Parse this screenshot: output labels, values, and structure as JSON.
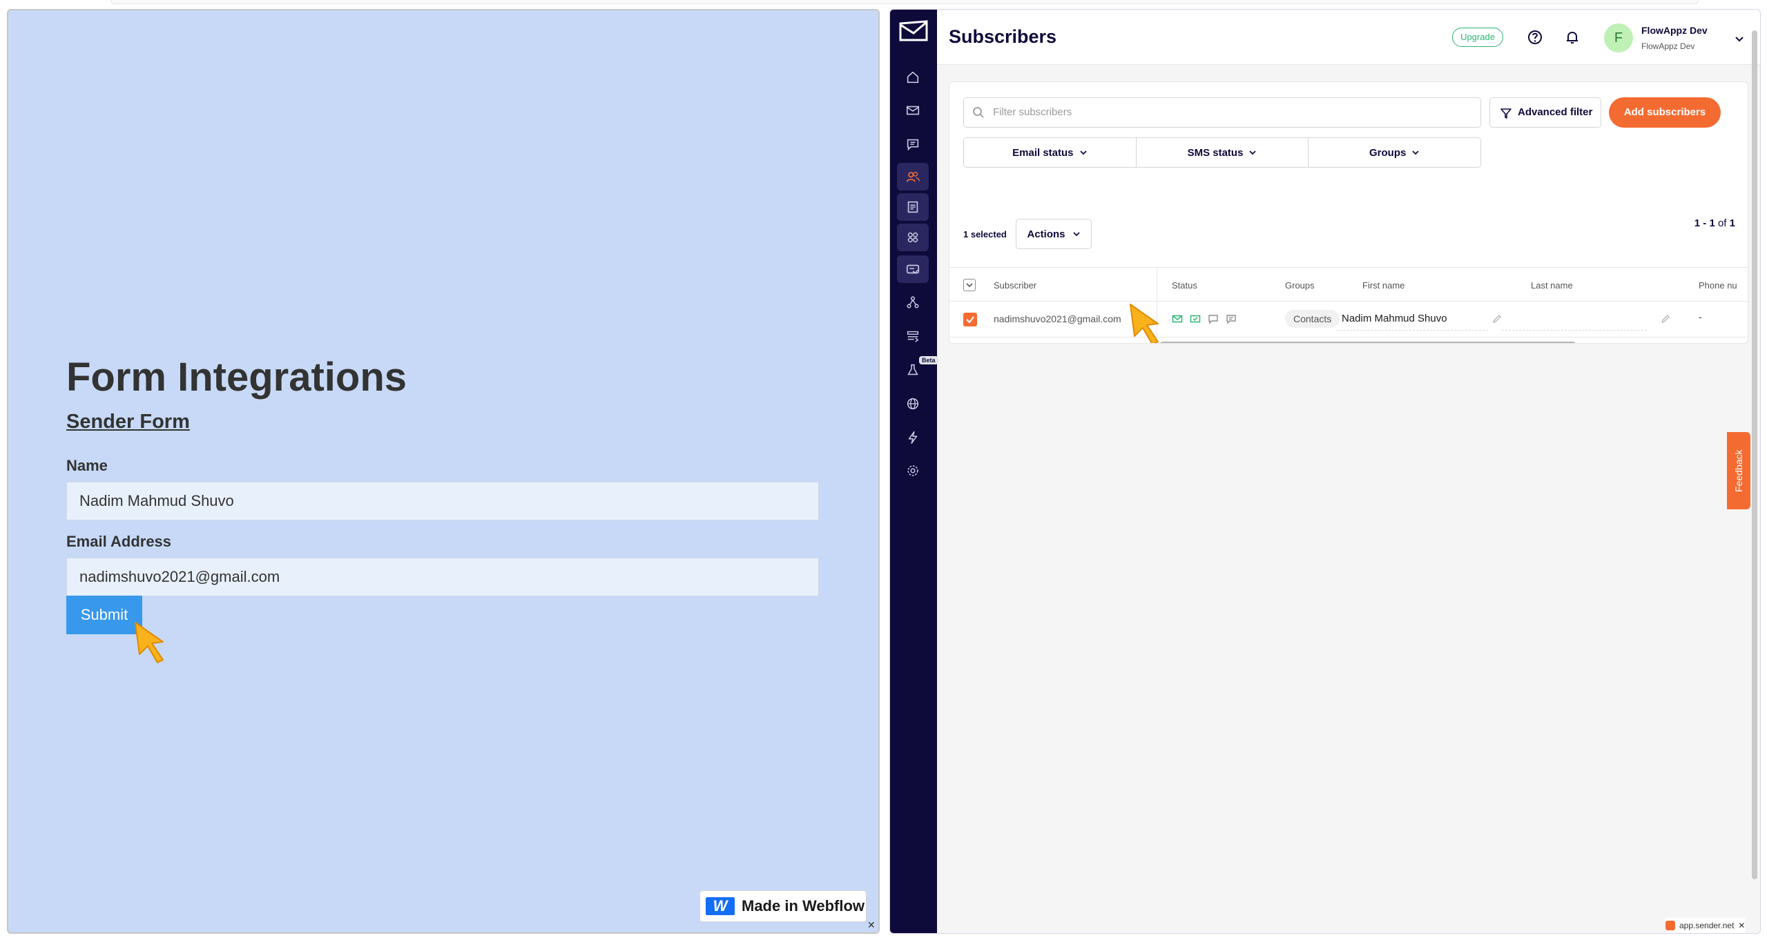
{
  "left_panel": {
    "title": "Form Integrations",
    "subtitle": "Sender Form",
    "name_label": "Name",
    "name_value": "Nadim Mahmud Shuvo",
    "email_label": "Email Address",
    "email_value": "nadimshuvo2021@gmail.com",
    "submit_label": "Submit",
    "badge_text": "Made in Webflow",
    "badge_logo": "W"
  },
  "sender_app": {
    "page_title": "Subscribers",
    "upgrade_label": "Upgrade",
    "account_initial": "F",
    "account_name": "FlowAppz Dev",
    "account_sub": "FlowAppz Dev",
    "beta_label": "Beta",
    "search_placeholder": "Filter subscribers",
    "advanced_filter_label": "Advanced filter",
    "add_subscribers_label": "Add subscribers",
    "filters": [
      "Email status",
      "SMS status",
      "Groups"
    ],
    "selected_text": "1 selected",
    "actions_label": "Actions",
    "pager": {
      "range": "1 - 1",
      "of": "of",
      "total": "1"
    },
    "columns": [
      "Subscriber",
      "Status",
      "Groups",
      "First name",
      "Last name",
      "Phone nu"
    ],
    "row": {
      "email": "nadimshuvo2021@gmail.com",
      "group": "Contacts",
      "first_name": "Nadim Mahmud Shuvo",
      "phone": "-"
    },
    "feedback_label": "Feedback",
    "domain_hint": "app.sender.net",
    "accent_color": "#f46b32",
    "sidebar_color": "#0e0a3a"
  },
  "close_glyph": "✕"
}
